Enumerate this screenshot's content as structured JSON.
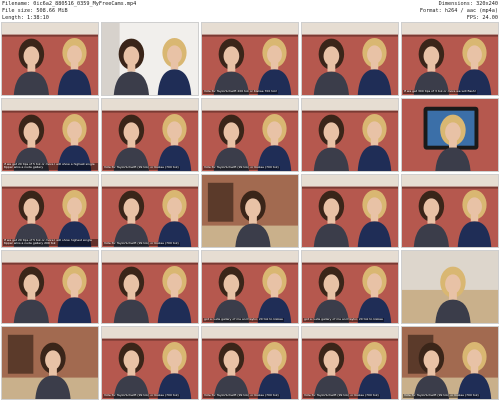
{
  "header": {
    "filename_label": "Filename:",
    "filename": "0ic6a2_880516_0359_MyFreeCams.mp4",
    "filesize_label": "File size:",
    "filesize": "508.66 MiB",
    "length_label": "Length:",
    "length": "1:38:10",
    "dimensions_label": "Dimensions:",
    "dimensions": "320x240",
    "format_label": "Format:",
    "format": "h264 / aac (mp4a)",
    "fps_label": "FPS:",
    "fps": "24.00"
  },
  "captions": {
    "c0": "",
    "c1": "",
    "c2": "Vote for TaylorSchwift 200 tok or Kiskae 700 tok!",
    "c3": "",
    "c4": "If we get 300 tips of 3 tok or more we will flash!",
    "c5": "if we get 20 tips of 5 tok or more I will show a highest single tipper wins a nude gallery",
    "c6": "Vote for TaylorSchwift (99 tok) or Kiskae (700 tok)",
    "c7": "Vote for TaylorSchwift (99 tok) or Kiskae (700 tok)",
    "c8": "",
    "c9": "",
    "c10": "If we get 20 tips of 5 tok or more I will show highest single tipper wins a nude gallery 200 tok",
    "c11": "Vote for TaylorSchwift (99 tok) or Kiskae (700 tok)",
    "c12": "",
    "c13": "",
    "c14": "",
    "c15": "",
    "c16": "",
    "c17": "got a nude gallery of me and taylor. 20 tok to kiskae",
    "c18": "got a nude gallery of me and taylor. 20 tok to kiskae",
    "c19": "",
    "c20": "",
    "c21": "Vote for TaylorSchwift (99 tok) or Kiskae (700 tok)",
    "c22": "Vote for TaylorSchwift (99 tok) or Kiskae (700 tok)",
    "c23": "Vote for TaylorSchwift (99 tok) or Kiskae (700 tok)",
    "c24": "Vote for TaylorSchwift (99 tok) or Kiskae (700 tok)"
  },
  "colors": {
    "wall_red": "#b5584e",
    "wall_dark": "#7a3a33",
    "ceiling": "#e6ddd2",
    "white_bg": "#f1efec",
    "hair_dark": "#3a2519",
    "hair_blonde": "#d9b772",
    "skin": "#e8c2a6",
    "top_dark": "#3b3d4a",
    "top_navy": "#1f2d56",
    "floor": "#c9b08b"
  }
}
